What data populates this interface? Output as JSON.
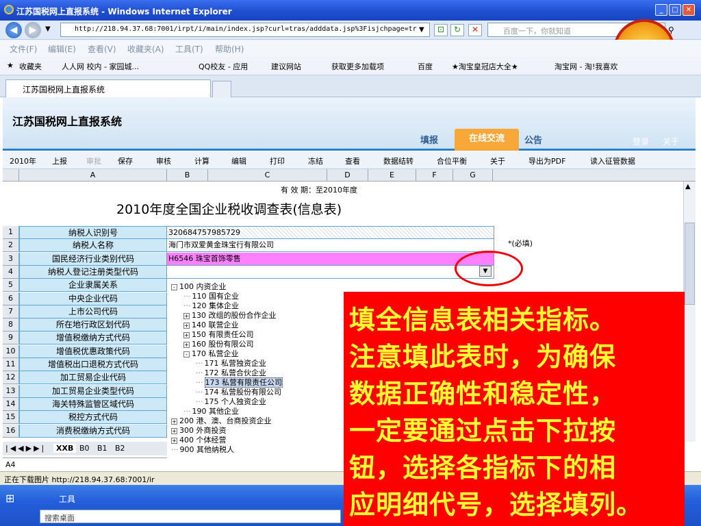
{
  "window": {
    "title": "江苏国税网上直报系统 - Windows Internet Explorer",
    "url": "http://218.94.37.68:7001/irpt/i/main/index.jsp?curl=tras/adddata.jsp%3Fisjchpage=tr",
    "search_placeholder": "百度一下，你就知道"
  },
  "menu": [
    "文件(F)",
    "编辑(E)",
    "查看(V)",
    "收藏夹(A)",
    "工具(T)",
    "帮助(H)"
  ],
  "favorites": [
    "收藏夹",
    "人人网 校内 - 家园城...",
    "QQ校友 - 应用",
    "建议网站",
    "获取更多加载项",
    "百度",
    "★淘宝皇冠店大全★",
    "淘宝网 - 淘!我喜欢"
  ],
  "tab": {
    "label": "江苏国税网上直报系统"
  },
  "site": {
    "title": "江苏国税网上直报系统",
    "nav": [
      "填报",
      "在线交流",
      "公告"
    ],
    "links": [
      "登录",
      "关于"
    ]
  },
  "toolbar": [
    "2010年",
    "上报",
    "审批",
    "保存",
    "审核",
    "计算",
    "编辑",
    "打印",
    "冻结",
    "查看",
    "数据结转",
    "合位平衡",
    "关于",
    "导出为PDF",
    "读入征管数据"
  ],
  "columns": [
    "A",
    "B",
    "C",
    "D",
    "E",
    "F",
    "G"
  ],
  "sheet": {
    "validity": "有 效 期：至2010年度",
    "title": "2010年度全国企业税收调查表(信息表)",
    "required_note": "*(必填)",
    "rows": [
      {
        "n": "1",
        "label": "纳税人识别号",
        "value": "320684757985729"
      },
      {
        "n": "2",
        "label": "纳税人名称",
        "value": "海门市双爱黄金珠宝行有限公司"
      },
      {
        "n": "3",
        "label": "国民经济行业类别代码",
        "value": "H6546 珠宝首饰零售"
      },
      {
        "n": "4",
        "label": "纳税人登记注册类型代码",
        "value": ""
      },
      {
        "n": "5",
        "label": "企业隶属关系",
        "value": ""
      },
      {
        "n": "6",
        "label": "中央企业代码",
        "value": ""
      },
      {
        "n": "7",
        "label": "上市公司代码",
        "value": ""
      },
      {
        "n": "8",
        "label": "所在地行政区划代码",
        "value": ""
      },
      {
        "n": "9",
        "label": "增值税缴纳方式代码",
        "value": ""
      },
      {
        "n": "10",
        "label": "增值税优惠政策代码",
        "value": ""
      },
      {
        "n": "11",
        "label": "增值税出口退税方式代码",
        "value": ""
      },
      {
        "n": "12",
        "label": "加工贸易企业代码",
        "value": ""
      },
      {
        "n": "13",
        "label": "加工贸易企业类型代码",
        "value": ""
      },
      {
        "n": "14",
        "label": "海关特殊监管区域代码",
        "value": ""
      },
      {
        "n": "15",
        "label": "税控方式代码",
        "value": ""
      },
      {
        "n": "16",
        "label": "消费税缴纳方式代码",
        "value": ""
      }
    ],
    "tree": [
      {
        "text": "100 内资企业",
        "level": 0,
        "exp": "-"
      },
      {
        "text": "110 国有企业",
        "level": 1,
        "exp": ""
      },
      {
        "text": "120 集体企业",
        "level": 1,
        "exp": ""
      },
      {
        "text": "130 改组的股份合作企业",
        "level": 1,
        "exp": "+"
      },
      {
        "text": "140 联营企业",
        "level": 1,
        "exp": "+"
      },
      {
        "text": "150 有限责任公司",
        "level": 1,
        "exp": "+"
      },
      {
        "text": "160 股份有限公司",
        "level": 1,
        "exp": "+"
      },
      {
        "text": "170 私营企业",
        "level": 1,
        "exp": "-"
      },
      {
        "text": "171 私营独资企业",
        "level": 2,
        "exp": ""
      },
      {
        "text": "172 私营合伙企业",
        "level": 2,
        "exp": ""
      },
      {
        "text": "173 私营有限责任公司",
        "level": 2,
        "exp": "",
        "selected": true
      },
      {
        "text": "174 私营股份有限公司",
        "level": 2,
        "exp": ""
      },
      {
        "text": "175 个人独资企业",
        "level": 2,
        "exp": ""
      },
      {
        "text": "190 其他企业",
        "level": 1,
        "exp": ""
      },
      {
        "text": "200 港、澳、台商投资企业",
        "level": 0,
        "exp": "+"
      },
      {
        "text": "300 外商投资",
        "level": 0,
        "exp": "+"
      },
      {
        "text": "400 个体经营",
        "level": 0,
        "exp": "+"
      },
      {
        "text": "900 其他纳税人",
        "level": 0,
        "exp": ""
      }
    ],
    "sheet_tabs": [
      "XXB",
      "B0",
      "B1",
      "B2"
    ],
    "cell_ref": "A4"
  },
  "status": "正在下载图片 http://218.94.37.68:7001/ir",
  "taskbar": {
    "tools": "工具",
    "search": "搜索桌面"
  },
  "callout": {
    "lines": [
      "填全信息表相关指标。",
      "注意填此表时，为确保",
      "数据正确性和稳定性，",
      "一定要通过点击下拉按",
      "钮，选择各指标下的相",
      "应明细代号，选择填列。"
    ]
  },
  "colors": {
    "accent": "#f7a838",
    "callout_bg": "#ff0000",
    "callout_text": "#ffff33",
    "label_bg": "#cde8f6"
  }
}
